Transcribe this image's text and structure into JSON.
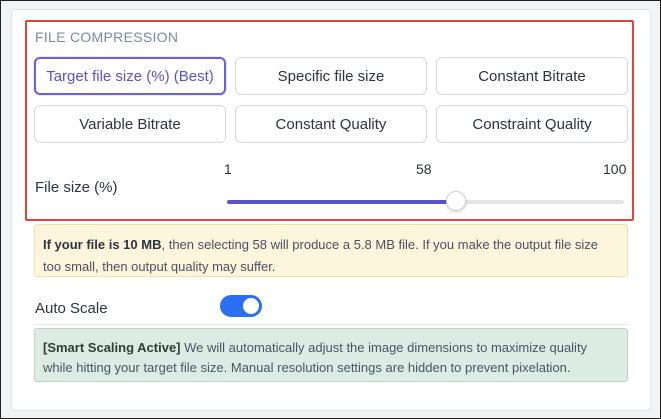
{
  "section": {
    "title": "FILE COMPRESSION"
  },
  "options": [
    {
      "label": "Target file size (%) (Best)",
      "selected": true
    },
    {
      "label": "Specific file size",
      "selected": false
    },
    {
      "label": "Constant Bitrate",
      "selected": false
    },
    {
      "label": "Variable Bitrate",
      "selected": false
    },
    {
      "label": "Constant Quality",
      "selected": false
    },
    {
      "label": "Constraint Quality",
      "selected": false
    }
  ],
  "file_size": {
    "label": "File size (%)",
    "min": 1,
    "value": 58,
    "max": 100,
    "min_label": "1",
    "value_label": "58",
    "max_label": "100"
  },
  "info": {
    "bold": "If your file is 10 MB",
    "text": ", then selecting 58 will produce a 5.8 MB file. If you make the output file size too small, then output quality may suffer."
  },
  "auto_scale": {
    "label": "Auto Scale",
    "enabled": true
  },
  "note": {
    "bold": "[Smart Scaling Active]",
    "text": " We will automatically adjust the image dimensions to maximize quality while hitting your target file size. Manual resolution settings are hidden to prevent pixelation."
  },
  "colors": {
    "accent": "#5b52cf",
    "toggle_on": "#2b6ff2",
    "highlight": "#e0453c",
    "info_bg": "#fdf6dd",
    "note_bg": "#dcebe3"
  }
}
